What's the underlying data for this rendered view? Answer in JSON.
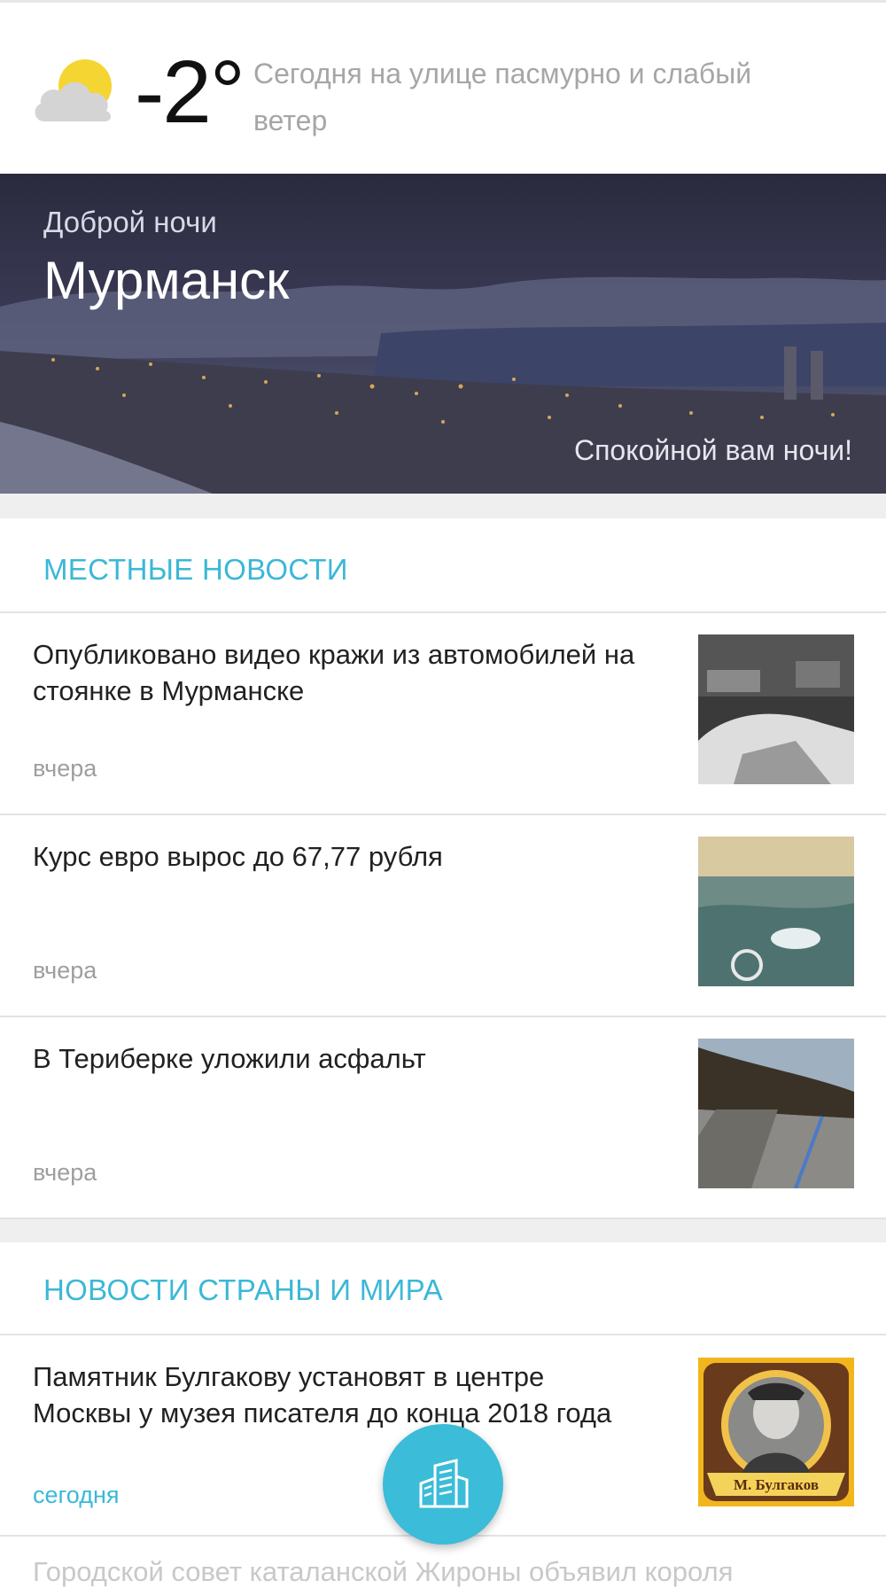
{
  "weather": {
    "icon": "partly-cloudy-icon",
    "temperature": "-2°",
    "description": "Сегодня на улице пасмурно и слабый ветер"
  },
  "hero": {
    "greeting": "Доброй ночи",
    "city": "Мурманск",
    "wish": "Спокойной вам ночи!"
  },
  "local_news": {
    "title": "МЕСТНЫЕ НОВОСТИ",
    "items": [
      {
        "title": "Опубликовано видео кражи из автомобилей на стоянке в Мурманске",
        "time": "вчера"
      },
      {
        "title": "Курс евро вырос до 67,77 рубля",
        "time": "вчера"
      },
      {
        "title": "В Териберке уложили асфальт",
        "time": "вчера"
      }
    ]
  },
  "world_news": {
    "title": "НОВОСТИ СТРАНЫ И МИРА",
    "items": [
      {
        "title": "Памятник Булгакову установят в центре Москвы у музея писателя до конца 2018 года",
        "time": "сегодня",
        "thumb_caption": "М. Булгаков"
      }
    ],
    "next_item_partial": "Городской совет каталанской Жироны объявил короля"
  },
  "fab": {
    "icon": "city-buildings-icon"
  },
  "colors": {
    "accent": "#3bb8d6",
    "sun": "#f5d531",
    "cloud": "#d4d4d4"
  }
}
